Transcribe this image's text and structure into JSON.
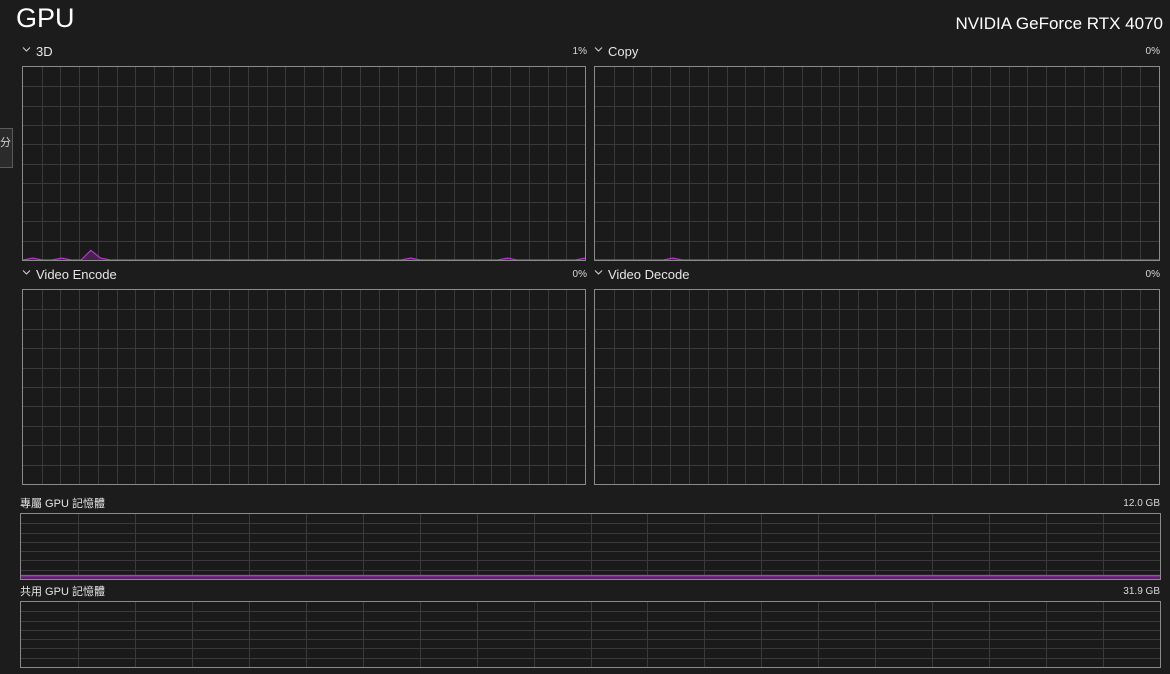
{
  "header": {
    "title": "GPU",
    "device_name": "NVIDIA GeForce RTX 4070"
  },
  "side_tab": {
    "glyph": "分"
  },
  "engines": [
    {
      "label": "3D",
      "percent": "1%",
      "usage": [
        0,
        1,
        0,
        0,
        1,
        0,
        0,
        5,
        1,
        0,
        0,
        0,
        0,
        0,
        0,
        0,
        0,
        0,
        0,
        0,
        0,
        0,
        0,
        0,
        0,
        0,
        0,
        0,
        0,
        0,
        0,
        0,
        0,
        0,
        0,
        0,
        0,
        0,
        0,
        0,
        1,
        0,
        0,
        0,
        0,
        0,
        0,
        0,
        0,
        0,
        1,
        0,
        0,
        0,
        0,
        0,
        0,
        0,
        1
      ]
    },
    {
      "label": "Copy",
      "percent": "0%",
      "usage": [
        0,
        0,
        0,
        0,
        0,
        0,
        0,
        0,
        1,
        0,
        0,
        0,
        0,
        0,
        0,
        0,
        0,
        0,
        0,
        0,
        0,
        0,
        0,
        0,
        0,
        0,
        0,
        0,
        0,
        0,
        0,
        0,
        0,
        0,
        0,
        0,
        0,
        0,
        0,
        0,
        0,
        0,
        0,
        0,
        0,
        0,
        0,
        0,
        0,
        0,
        0,
        0,
        0,
        0,
        0,
        0,
        0,
        0,
        0
      ]
    },
    {
      "label": "Video Encode",
      "percent": "0%",
      "usage": []
    },
    {
      "label": "Video Decode",
      "percent": "0%",
      "usage": []
    }
  ],
  "memory": [
    {
      "label": "專屬 GPU 記憶體",
      "capacity": "12.0 GB",
      "usage_fraction": 0.06
    },
    {
      "label": "共用 GPU 記憶體",
      "capacity": "31.9 GB",
      "usage_fraction": 0
    }
  ],
  "colors": {
    "accent": "#b23bc8",
    "fill": "#5a2566",
    "grid": "#3a3a3a",
    "border": "#8a8a8a"
  }
}
